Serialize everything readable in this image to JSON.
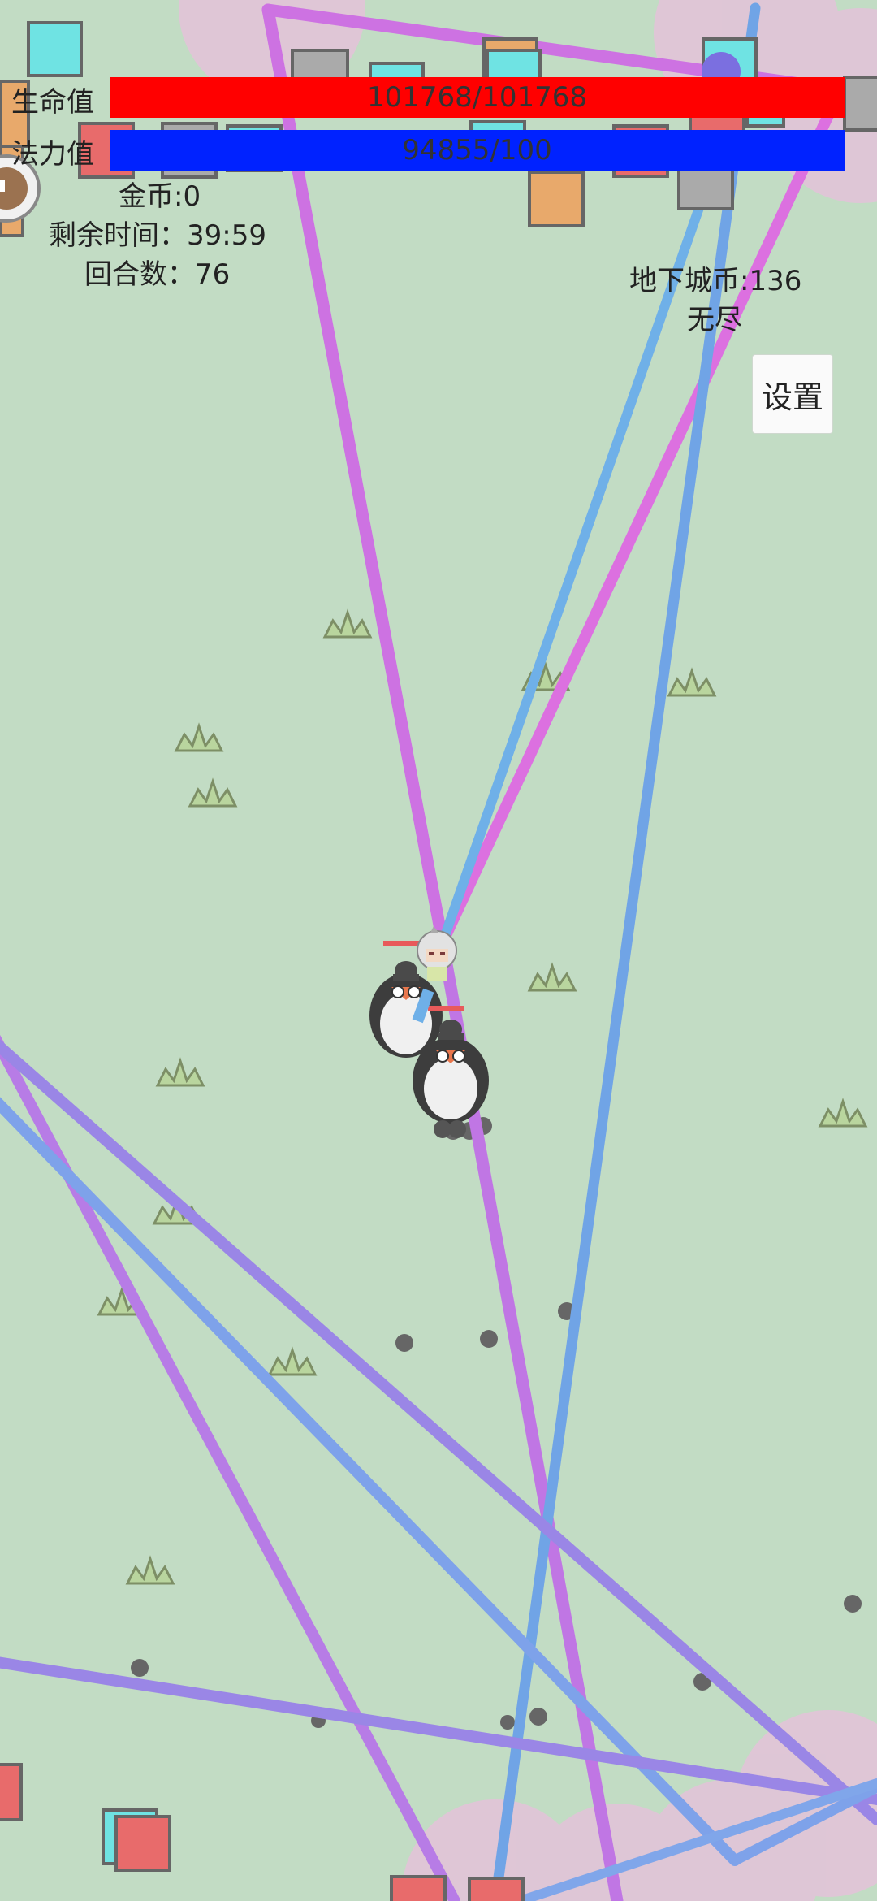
{
  "hud": {
    "hp_label": "生命值",
    "hp_value": "101768/101768",
    "hp_fraction": 1.0,
    "mp_label": "法力值",
    "mp_value": "94855/100",
    "mp_fraction": 1.0,
    "gold": "金币:0",
    "time_remaining": "剩余时间：39:59",
    "round": "回合数：76",
    "dungeon_coins": "地下城币:136",
    "mode": "无尽",
    "settings_label": "设置"
  },
  "colors": {
    "background": "#c2dcc4",
    "hp_bar": "#ff0000",
    "mp_bar": "#0022ff",
    "laser_magenta": "#d873e8",
    "laser_blue": "#6fa8e8",
    "laser_violet": "#9a86e6",
    "enemy_red": "#e86b6b",
    "enemy_cyan": "#6fe3e3",
    "enemy_orange": "#e8a96b",
    "enemy_gray": "#aaaaaa"
  }
}
